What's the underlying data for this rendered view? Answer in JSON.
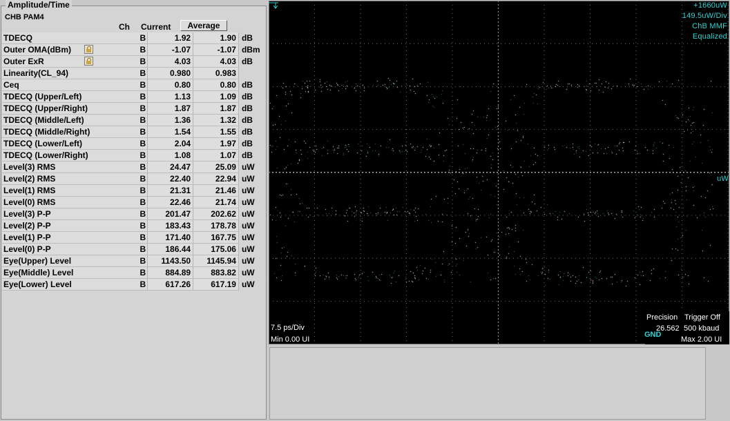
{
  "panel": {
    "title": "Amplitude/Time",
    "signal": "CHB PAM4",
    "headers": {
      "ch": "Ch",
      "current": "Current",
      "average": "Average"
    }
  },
  "rows": [
    {
      "name": "TDECQ",
      "ch": "B",
      "current": "1.92",
      "average": "1.90",
      "unit": "dB",
      "locked": false
    },
    {
      "name": "Outer OMA(dBm)",
      "ch": "B",
      "current": "-1.07",
      "average": "-1.07",
      "unit": "dBm",
      "locked": true
    },
    {
      "name": "Outer ExR",
      "ch": "B",
      "current": "4.03",
      "average": "4.03",
      "unit": "dB",
      "locked": true
    },
    {
      "name": "Linearity(CL_94)",
      "ch": "B",
      "current": "0.980",
      "average": "0.983",
      "unit": "",
      "locked": false
    },
    {
      "name": "Ceq",
      "ch": "B",
      "current": "0.80",
      "average": "0.80",
      "unit": "dB",
      "locked": false
    },
    {
      "name": "TDECQ (Upper/Left)",
      "ch": "B",
      "current": "1.13",
      "average": "1.09",
      "unit": "dB",
      "locked": false
    },
    {
      "name": "TDECQ (Upper/Right)",
      "ch": "B",
      "current": "1.87",
      "average": "1.87",
      "unit": "dB",
      "locked": false
    },
    {
      "name": "TDECQ (Middle/Left)",
      "ch": "B",
      "current": "1.36",
      "average": "1.32",
      "unit": "dB",
      "locked": false
    },
    {
      "name": "TDECQ (Middle/Right)",
      "ch": "B",
      "current": "1.54",
      "average": "1.55",
      "unit": "dB",
      "locked": false
    },
    {
      "name": "TDECQ (Lower/Left)",
      "ch": "B",
      "current": "2.04",
      "average": "1.97",
      "unit": "dB",
      "locked": false
    },
    {
      "name": "TDECQ (Lower/Right)",
      "ch": "B",
      "current": "1.08",
      "average": "1.07",
      "unit": "dB",
      "locked": false
    },
    {
      "name": "Level(3) RMS",
      "ch": "B",
      "current": "24.47",
      "average": "25.09",
      "unit": "uW",
      "locked": false
    },
    {
      "name": "Level(2) RMS",
      "ch": "B",
      "current": "22.40",
      "average": "22.94",
      "unit": "uW",
      "locked": false
    },
    {
      "name": "Level(1) RMS",
      "ch": "B",
      "current": "21.31",
      "average": "21.46",
      "unit": "uW",
      "locked": false
    },
    {
      "name": "Level(0) RMS",
      "ch": "B",
      "current": "22.46",
      "average": "21.74",
      "unit": "uW",
      "locked": false
    },
    {
      "name": "Level(3) P-P",
      "ch": "B",
      "current": "201.47",
      "average": "202.62",
      "unit": "uW",
      "locked": false
    },
    {
      "name": "Level(2) P-P",
      "ch": "B",
      "current": "183.43",
      "average": "178.78",
      "unit": "uW",
      "locked": false
    },
    {
      "name": "Level(1) P-P",
      "ch": "B",
      "current": "171.40",
      "average": "167.75",
      "unit": "uW",
      "locked": false
    },
    {
      "name": "Level(0) P-P",
      "ch": "B",
      "current": "186.44",
      "average": "175.06",
      "unit": "uW",
      "locked": false
    },
    {
      "name": "Eye(Upper)  Level",
      "ch": "B",
      "current": "1143.50",
      "average": "1145.94",
      "unit": "uW",
      "locked": false
    },
    {
      "name": "Eye(Middle) Level",
      "ch": "B",
      "current": "884.89",
      "average": "883.82",
      "unit": "uW",
      "locked": false
    },
    {
      "name": "Eye(Lower)  Level",
      "ch": "B",
      "current": "617.26",
      "average": "617.19",
      "unit": "uW",
      "locked": false
    }
  ],
  "scope": {
    "scale_lines": [
      "+1660uW",
      "149.5uW/Div",
      "ChB  MMF",
      "Equalized"
    ],
    "marker": "uW",
    "time_div": "7.5 ps/Div",
    "min_ui": "Min 0.00 UI",
    "precision": "Precision",
    "trigger": "Trigger Off",
    "rate_left": "26.562",
    "rate_right": "500 kbaud",
    "max_ui": "Max 2.00 UI",
    "gnd": "GND",
    "trace_color": "#2fd3d3"
  }
}
